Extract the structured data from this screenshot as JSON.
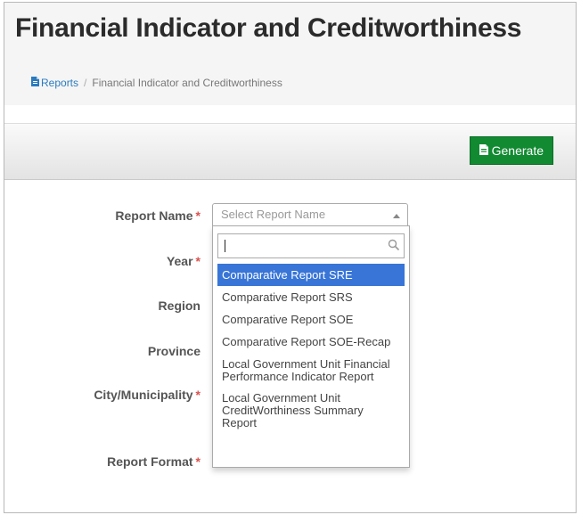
{
  "page": {
    "title": "Financial Indicator and Creditworthiness"
  },
  "breadcrumb": {
    "icon": "document-icon",
    "home_label": "Reports",
    "separator": "/",
    "current": "Financial Indicator and Creditworthiness"
  },
  "toolbar": {
    "generate_label": "Generate",
    "generate_icon": "document-icon",
    "generate_color": "#118a32"
  },
  "form": {
    "required_marker": "*",
    "fields": {
      "report_name": "Report Name",
      "year": "Year",
      "region": "Region",
      "province": "Province",
      "city": "City/Municipality",
      "report_format": "Report Format"
    },
    "report_name_select": {
      "placeholder": "Select Report Name",
      "search_value": "",
      "highlight_color": "#3875d7",
      "options": [
        {
          "label": "Comparative Report SRE",
          "highlighted": true
        },
        {
          "label": "Comparative Report SRS",
          "highlighted": false
        },
        {
          "label": "Comparative Report SOE",
          "highlighted": false
        },
        {
          "label": "Comparative Report SOE-Recap",
          "highlighted": false
        },
        {
          "label": "Local Government Unit Financial Performance Indicator Report",
          "highlighted": false
        },
        {
          "label": "Local Government Unit CreditWorthiness Summary Report",
          "highlighted": false
        }
      ]
    }
  }
}
